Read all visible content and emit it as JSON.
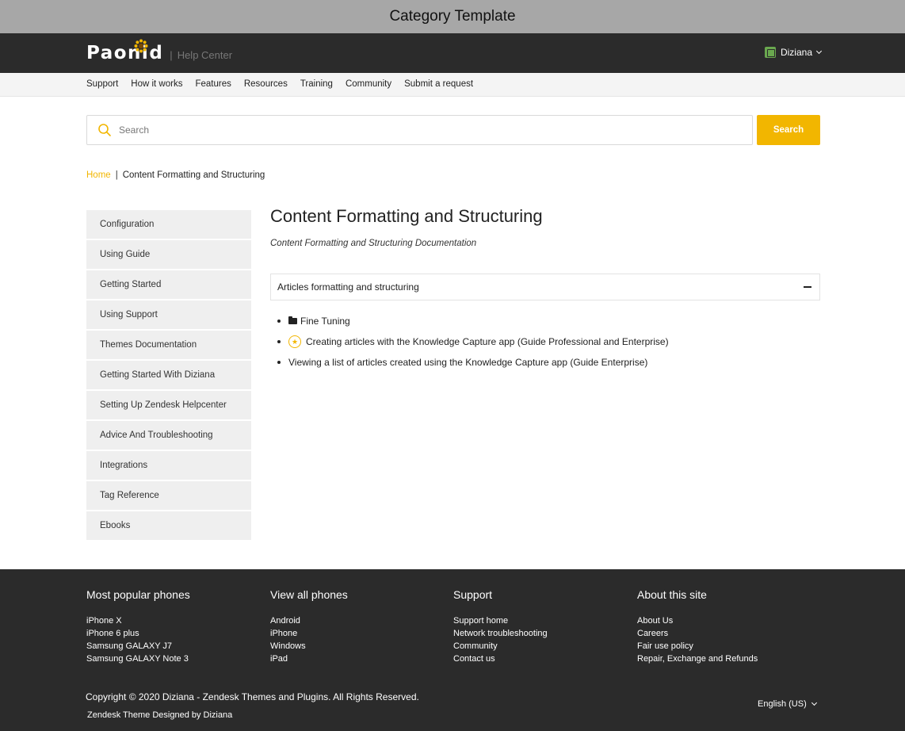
{
  "window": {
    "title": "Category Template"
  },
  "header": {
    "logo_text": "Paonid",
    "logo_separator": "|",
    "logo_subtitle": "Help Center",
    "user_name": "Diziana",
    "colors": {
      "topbar": "#2b2b2b",
      "accent": "#f2b600"
    }
  },
  "nav": {
    "items": [
      {
        "label": "Support"
      },
      {
        "label": "How it works"
      },
      {
        "label": "Features"
      },
      {
        "label": "Resources"
      },
      {
        "label": "Training"
      },
      {
        "label": "Community"
      },
      {
        "label": "Submit a request"
      }
    ]
  },
  "search": {
    "placeholder": "Search",
    "value": "",
    "button_label": "Search",
    "icon": "search-icon"
  },
  "breadcrumb": {
    "home": "Home",
    "separator": "|",
    "current": "Content Formatting and Structuring"
  },
  "sidebar": {
    "items": [
      {
        "label": "Configuration"
      },
      {
        "label": "Using Guide"
      },
      {
        "label": "Getting Started"
      },
      {
        "label": "Using Support"
      },
      {
        "label": "Themes Documentation"
      },
      {
        "label": "Getting Started With Diziana"
      },
      {
        "label": "Setting Up Zendesk Helpcenter"
      },
      {
        "label": "Advice And Troubleshooting"
      },
      {
        "label": "Integrations"
      },
      {
        "label": "Tag Reference"
      },
      {
        "label": "Ebooks"
      }
    ]
  },
  "main": {
    "title": "Content Formatting and Structuring",
    "description": "Content Formatting and Structuring Documentation",
    "section": {
      "title": "Articles formatting and structuring",
      "collapse_icon": "minus-icon",
      "articles": [
        {
          "label": "Fine Tuning",
          "icon": "folder-icon"
        },
        {
          "label": "Creating articles with the Knowledge Capture app (Guide Professional and Enterprise)",
          "icon": "star-icon"
        },
        {
          "label": "Viewing a list of articles created using the Knowledge Capture app (Guide Enterprise)",
          "icon": ""
        }
      ]
    }
  },
  "footer": {
    "columns": [
      {
        "title": "Most popular phones",
        "links": [
          "iPhone X",
          "iPhone 6 plus",
          "Samsung GALAXY J7",
          "Samsung GALAXY Note 3"
        ]
      },
      {
        "title": "View all phones",
        "links": [
          "Android",
          "iPhone",
          "Windows",
          "iPad"
        ]
      },
      {
        "title": "Support",
        "links": [
          "Support home",
          "Network troubleshooting",
          "Community",
          "Contact us"
        ]
      },
      {
        "title": "About this site",
        "links": [
          "About Us",
          "Careers",
          "Fair use policy",
          "Repair, Exchange and Refunds"
        ]
      }
    ],
    "copyright": "Copyright © 2020 Diziana - Zendesk Themes and Plugins. All Rights Reserved.",
    "designed_by": "Zendesk Theme Designed by Diziana",
    "language": "English (US)"
  }
}
